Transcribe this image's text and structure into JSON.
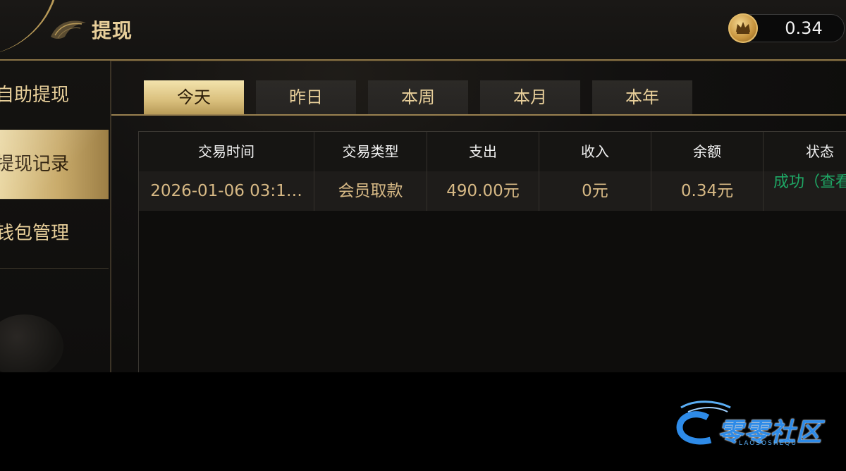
{
  "header": {
    "title": "提现",
    "balance": "0.34"
  },
  "sidebar": {
    "items": [
      {
        "label": "自助提现"
      },
      {
        "label": "提现记录"
      },
      {
        "label": "钱包管理"
      }
    ],
    "active_index": 1
  },
  "tabs": {
    "items": [
      {
        "label": "今天"
      },
      {
        "label": "昨日"
      },
      {
        "label": "本周"
      },
      {
        "label": "本月"
      },
      {
        "label": "本年"
      }
    ],
    "active_index": 0
  },
  "table": {
    "columns": [
      "交易时间",
      "交易类型",
      "支出",
      "收入",
      "余额",
      "状态"
    ],
    "rows": [
      [
        "2026-01-06 03:1…",
        "会员取款",
        "490.00元",
        "0元",
        "0.34元",
        "成功（查看）"
      ]
    ]
  },
  "colors": {
    "gold_text": "#e8cf9a",
    "active_gold": "#d9bf7c",
    "status_success": "#1ea765",
    "background": "#0e0d0c"
  },
  "icons": [
    "back-arc-icon",
    "wing-icon",
    "crown-coin-icon",
    "watermark-logo-icon"
  ],
  "watermark": {
    "text": "零零社区",
    "sub": "LAOSOSHEQU"
  }
}
